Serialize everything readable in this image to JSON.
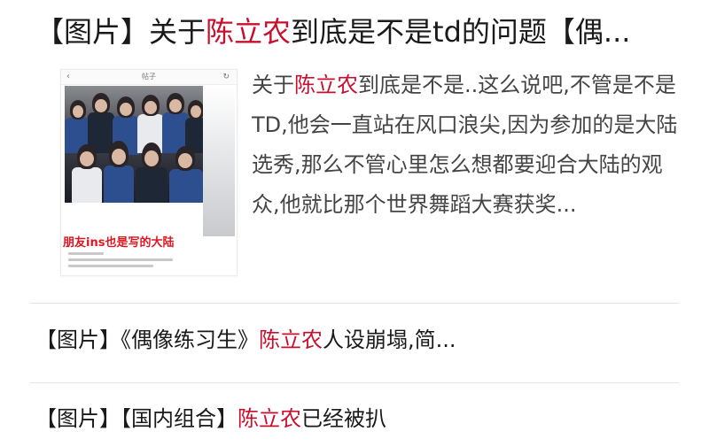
{
  "colors": {
    "keyword": "#c8102e",
    "text": "#1a1a1a",
    "summary_text": "#444444",
    "caption_red": "#e0151f",
    "divider": "#e4e4e4"
  },
  "headline": {
    "prefix": "【图片】关于",
    "keyword": "陈立农",
    "suffix": "到底是不是td的问题【偶..."
  },
  "thumbnail": {
    "back_icon": "chevron-left-icon",
    "top_title": "帖子",
    "refresh_icon": "refresh-icon",
    "caption": "朋友ins也是写的大陆"
  },
  "summary": {
    "prefix": "关于",
    "keyword": "陈立农",
    "suffix": "到底是不是..这么说吧,不管是不是TD,他会一直站在风口浪尖,因为参加的是大陆选秀,那么不管心里怎么想都要迎合大陆的观众,他就比那个世界舞蹈大赛获奖..."
  },
  "related": [
    {
      "prefix": "【图片】《偶像练习生》",
      "keyword": "陈立农",
      "suffix": "人设崩塌,简..."
    },
    {
      "prefix": "【图片】【国内组合】",
      "keyword": "陈立农",
      "suffix": "已经被扒"
    }
  ]
}
